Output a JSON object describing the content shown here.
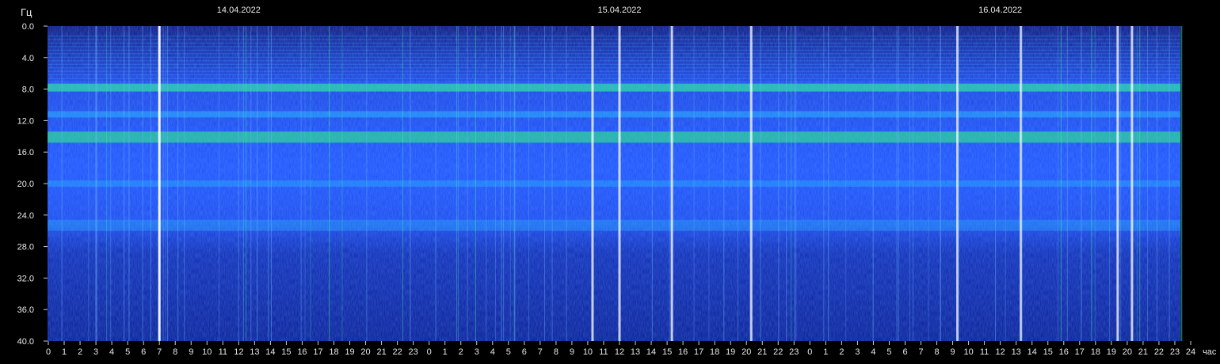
{
  "chart_data": {
    "type": "heatmap",
    "title": "",
    "ylabel": "Гц",
    "xlabel": "час",
    "ylim": [
      0,
      40
    ],
    "y_direction": "down",
    "yticks": [
      "0.0",
      "4.0",
      "8.0",
      "12.0",
      "16.0",
      "20.0",
      "24.0",
      "28.0",
      "32.0",
      "36.0",
      "40.0"
    ],
    "x_hours_per_day": 24,
    "x_total_hours": 72,
    "x_end_label": "24",
    "days": [
      "14.04.2022",
      "15.04.2022",
      "16.04.2022"
    ],
    "colors": {
      "background": "#000000",
      "low": "#0a1a8c",
      "mid": "#1e5cff",
      "high": "#3ad7ff",
      "peak": "#36ff5a",
      "max": "#ffffff"
    },
    "horizontal_bands_hz": [
      7.8,
      11.2,
      14.1,
      20.0,
      25.3
    ],
    "strong_vertical_events_hours": [
      7.0,
      34.3,
      36.0,
      39.3,
      44.3,
      57.3,
      61.3,
      67.4,
      68.3
    ]
  }
}
